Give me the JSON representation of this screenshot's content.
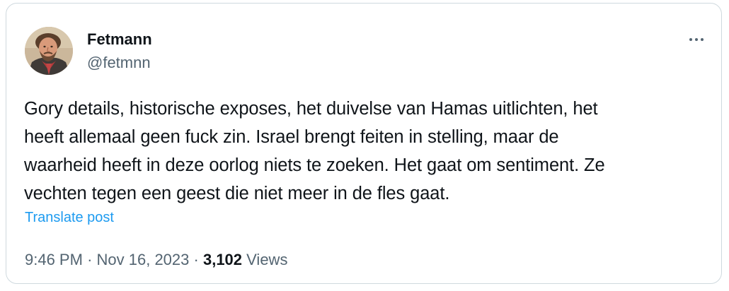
{
  "author": {
    "name": "Fetmann",
    "handle": "@fetmnn"
  },
  "post": {
    "text_lines": [
      "Gory details, historische exposes, het duivelse van Hamas uitlichten, het",
      "heeft allemaal geen fuck zin. Israel brengt feiten in stelling, maar de",
      "waarheid heeft in deze oorlog niets te zoeken. Het gaat om sentiment. Ze",
      "vechten tegen een geest die niet meer in de fles gaat."
    ],
    "translate_label": "Translate post"
  },
  "meta": {
    "time": "9:46 PM",
    "separator": "·",
    "date": "Nov 16, 2023",
    "views_count": "3,102",
    "views_label": "Views"
  },
  "icons": {
    "more": "more-options-icon"
  },
  "colors": {
    "text": "#0f1419",
    "secondary": "#536471",
    "link": "#1d9bf0",
    "border": "#cfd9de"
  }
}
